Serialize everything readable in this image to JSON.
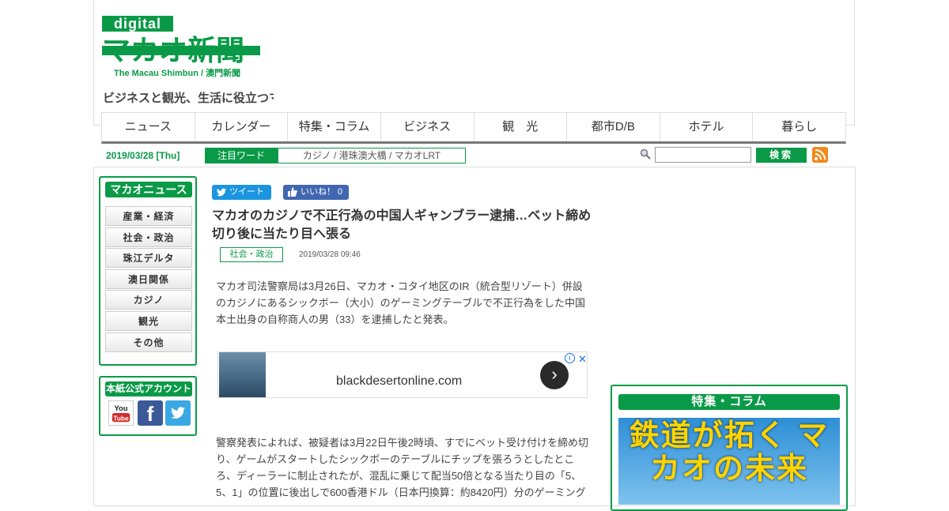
{
  "logo": {
    "digital": "digital",
    "main": "マカオ新聞",
    "sub": "The Macau Shimbun / 澳門新聞"
  },
  "tagline": "ビジネスと観光、生活に役立つマカ",
  "nav": [
    "ニュース",
    "カレンダー",
    "特集・コラム",
    "ビジネス",
    "観　光",
    "都市D/B",
    "ホテル",
    "暮らし"
  ],
  "date": "2019/03/28 [Thu]",
  "trend": {
    "label": "注目ワード",
    "words": "カジノ / 港珠澳大橋 / マカオLRT"
  },
  "search": {
    "button": "検索"
  },
  "sidebar": {
    "title": "マカオニュース",
    "items": [
      "産業・経済",
      "社会・政治",
      "珠江デルタ",
      "澳日関係",
      "カジノ",
      "観光",
      "その他"
    ],
    "account_title": "本紙公式アカウント",
    "youtube": "You Tube",
    "facebook": "f"
  },
  "article": {
    "tweet": "ツイート",
    "like": "いいね！ 0",
    "title": "マカオのカジノで不正行為の中国人ギャンブラー逮捕…ベット締め切り後に当たり目へ張る",
    "category": "社会・政治",
    "published": "2019/03/28 09:46",
    "para1": "マカオ司法警察局は3月26日、マカオ・コタイ地区のIR（統合型リゾート）併設のカジノにあるシックボー（大小）のゲーミングテーブルで不正行為をした中国本土出身の自称商人の男（33）を逮捕したと発表。",
    "para2": "警察発表によれば、被疑者は3月22日午後2時頃、すでにベット受け付けを締め切り、ゲームがスタートしたシックボーのテーブルにチップを張ろうとしたところ、ディーラーに制止されたが、混乱に乗じて配当50倍となる当たり目の「5、5、1」の位置に後出しで600香港ドル（日本円換算：約8420円）分のゲーミング"
  },
  "ad": {
    "domain": "blackdesertonline.com",
    "close": "✕",
    "info": "i",
    "arrow": "›"
  },
  "feature": {
    "title": "特集・コラム",
    "banner": "鉄道が拓く マカオの未来"
  },
  "colors": {
    "brand": "#0a9a47",
    "twitter": "#1b95e0",
    "facebook": "#4267b2",
    "rss": "#f28a1e"
  }
}
